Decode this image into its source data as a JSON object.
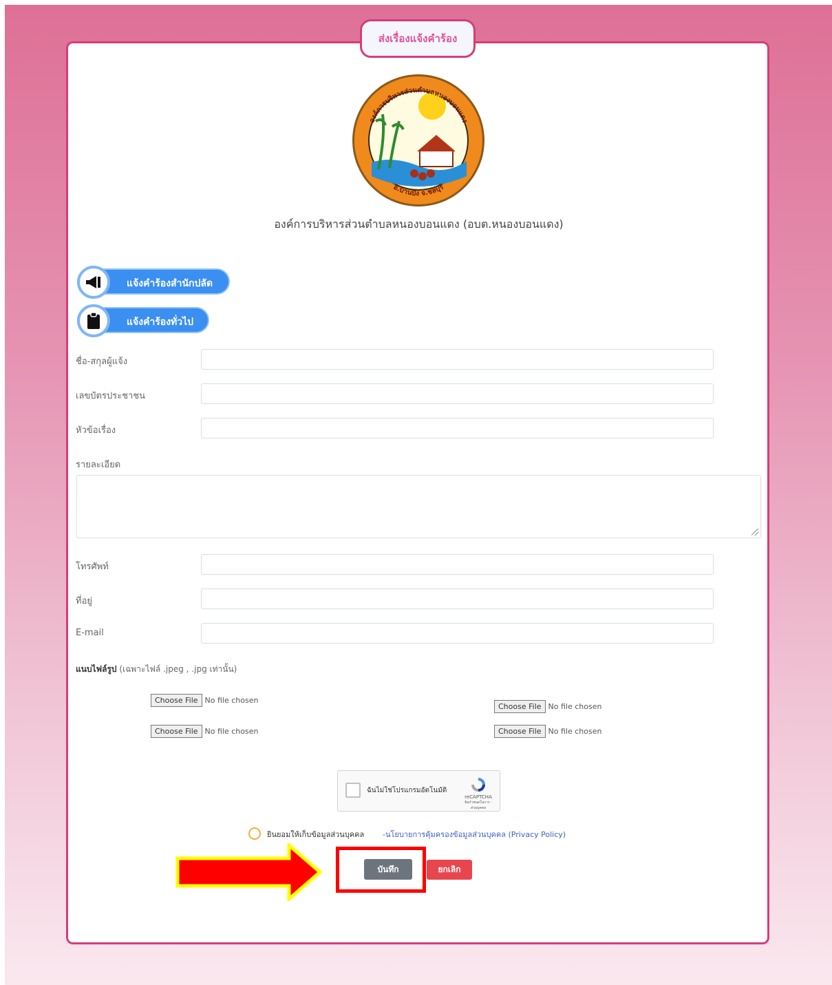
{
  "title_tab": "ส่งเรื่องแจ้งคำร้อง",
  "logo": {
    "top_text": "องค์การบริหารส่วนตำบลหนองบอนแดง",
    "bottom_text": "อ.บ้านบึง จ.ชลบุรี"
  },
  "org_name": "องค์การบริหารส่วนตำบลหนองบอนแดง (อบต.หนองบอนแดง)",
  "category_buttons": [
    {
      "label": "แจ้งคำร้องสำนักปลัด",
      "icon": "megaphone-icon"
    },
    {
      "label": "แจ้งคำร้องทั่วไป",
      "icon": "clipboard-icon"
    }
  ],
  "form": {
    "name_label": "ชื่อ-สกุลผู้แจ้ง",
    "name_value": "",
    "id_label": "เลขบัตรประชาชน",
    "id_value": "",
    "subject_label": "หัวข้อเรื่อง",
    "subject_value": "",
    "detail_label": "รายละเอียด",
    "detail_value": "",
    "phone_label": "โทรศัพท์",
    "phone_value": "",
    "address_label": "ที่อยู่",
    "address_value": "",
    "email_label": "E-mail",
    "email_value": ""
  },
  "upload": {
    "label": "แนบไฟล์รูป",
    "hint": "(เฉพาะไฟล์ .jpeg , .jpg เท่านั้น)",
    "files": [
      {
        "button": "Choose File",
        "status": "No file chosen"
      },
      {
        "button": "Choose File",
        "status": "No file chosen"
      },
      {
        "button": "Choose File",
        "status": "No file chosen"
      },
      {
        "button": "Choose File",
        "status": "No file chosen"
      }
    ]
  },
  "recaptcha": {
    "label": "ฉันไม่ใช่โปรแกรมอัตโนมัติ",
    "brand": "reCAPTCHA",
    "links": "ข้อกำหนดในการ - ส่วนบุคคล"
  },
  "consent": {
    "text": "ยินยอมให้เก็บข้อมูลส่วนบุคคล",
    "link": "-นโยบายการคุ้มครองข้อมูลส่วนบุคคล (Privacy Policy)"
  },
  "buttons": {
    "save": "บันทึก",
    "cancel": "ยกเลิก"
  },
  "colors": {
    "accent": "#d43d7a",
    "pill_blue": "#3b8ff0",
    "save_gray": "#6c757d",
    "cancel_red": "#e8464e",
    "annotation_red": "#ff0000",
    "annotation_yellow": "#ffff00"
  }
}
